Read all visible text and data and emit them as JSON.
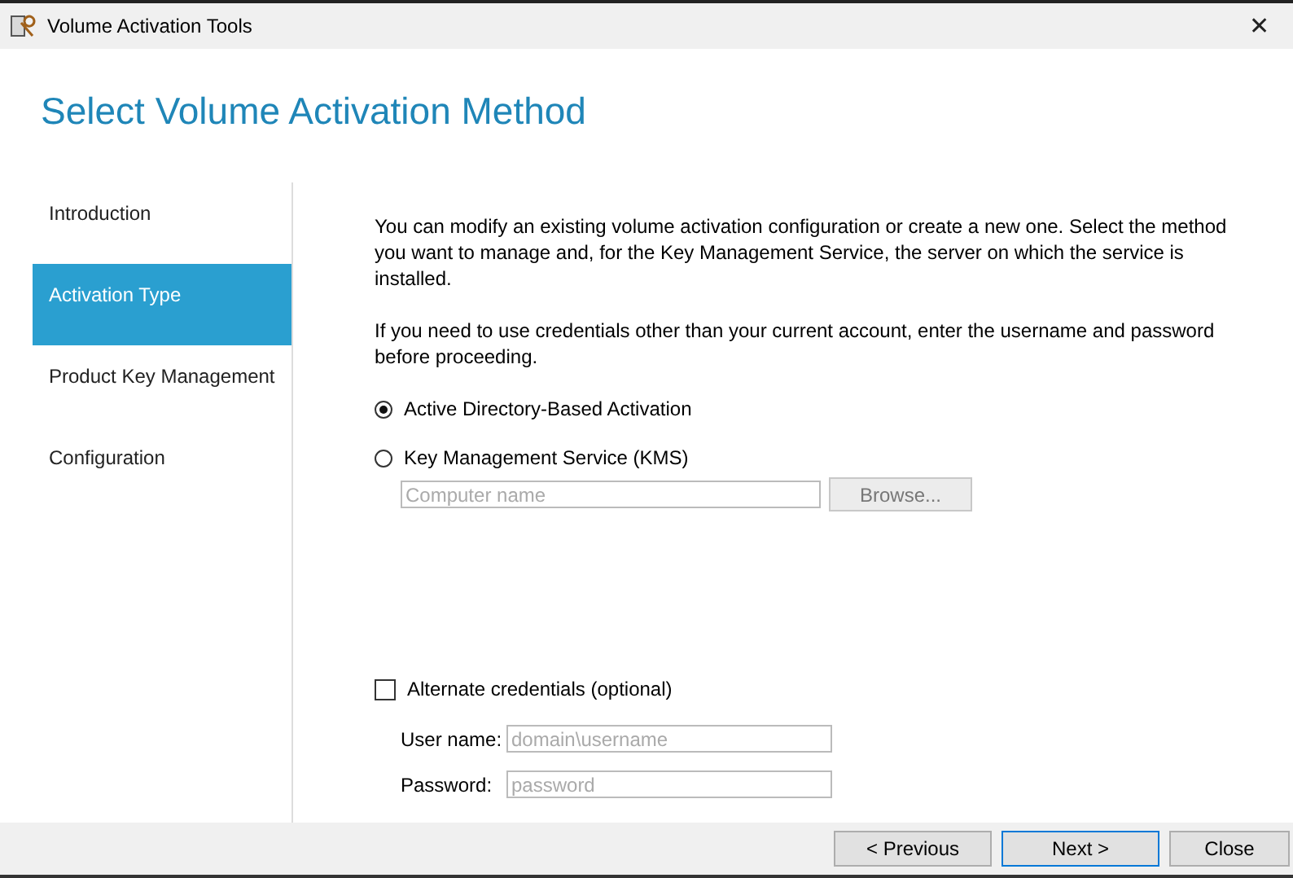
{
  "window": {
    "title": "Volume Activation Tools",
    "close": "✕"
  },
  "heading": "Select Volume Activation Method",
  "sidebar": {
    "items": [
      {
        "label": "Introduction",
        "selected": false
      },
      {
        "label": "Activation Type",
        "selected": true
      },
      {
        "label": "Product Key Management",
        "selected": false
      },
      {
        "label": "Configuration",
        "selected": false
      }
    ]
  },
  "description": [
    "You can modify an existing volume activation configuration or create a new one. Select the method you want to manage and, for the Key Management Service, the server on which the service is installed.",
    "If you need to use credentials other than your current account, enter the username and password before proceeding."
  ],
  "methods": [
    {
      "label": "Active Directory-Based Activation",
      "selected": true
    },
    {
      "label": "Key Management Service (KMS)",
      "selected": false
    }
  ],
  "computer_name": {
    "placeholder": "Computer name",
    "disabled": true
  },
  "browse_button": {
    "label": "Browse...",
    "disabled": true
  },
  "alternate_credentials": {
    "label": "Alternate credentials (optional)",
    "checked": false
  },
  "credentials": [
    {
      "label": "User name:",
      "placeholder": "domain\\username",
      "disabled": true
    },
    {
      "label": "Password:",
      "placeholder": "password",
      "disabled": true
    }
  ],
  "buttons": [
    {
      "label": "< Previous",
      "focused": false
    },
    {
      "label": "Next >",
      "focused": true
    },
    {
      "label": "Close",
      "focused": false
    }
  ]
}
